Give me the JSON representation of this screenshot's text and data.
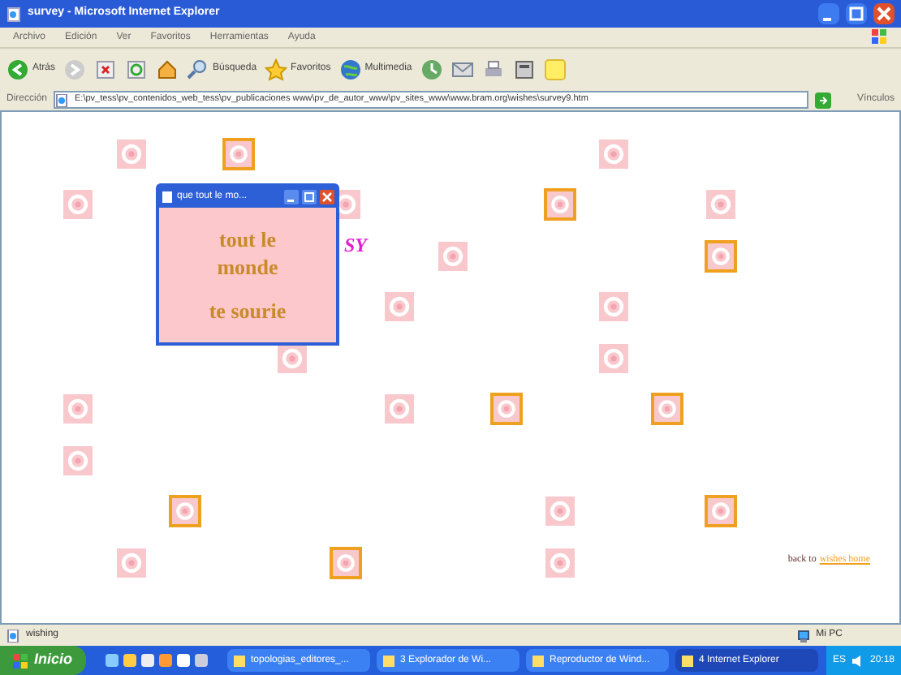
{
  "window": {
    "title": "survey - Microsoft Internet Explorer"
  },
  "menu": [
    "Archivo",
    "Edición",
    "Ver",
    "Favoritos",
    "Herramientas",
    "Ayuda"
  ],
  "toolbar": [
    {
      "kind": "back",
      "label": "Atrás"
    },
    {
      "kind": "forward"
    },
    {
      "kind": "stop"
    },
    {
      "kind": "refresh"
    },
    {
      "kind": "home"
    },
    {
      "kind": "search",
      "label": "Búsqueda"
    },
    {
      "kind": "favorites",
      "label": "Favoritos"
    },
    {
      "kind": "media",
      "label": "Multimedia"
    },
    {
      "kind": "history"
    },
    {
      "kind": "mail"
    },
    {
      "kind": "print"
    },
    {
      "kind": "edit"
    },
    {
      "kind": "note"
    }
  ],
  "address": {
    "label": "Dirección",
    "value": "E:\\pv_tess\\pv_contenidos_web_tess\\pv_publicaciones www\\pv_de_autor_www\\pv_sites_www\\www.bram.org\\wishes\\survey9.htm",
    "links": "Vínculos"
  },
  "grid": [
    {
      "cells": [
        {
          "kind": "empty"
        },
        {
          "kind": "tile"
        },
        {
          "kind": "empty"
        },
        {
          "kind": "framed"
        },
        {
          "kind": "empty"
        },
        {
          "kind": "empty"
        },
        {
          "kind": "empty"
        },
        {
          "kind": "empty"
        },
        {
          "kind": "empty"
        },
        {
          "kind": "empty"
        },
        {
          "kind": "tile"
        },
        {
          "kind": "empty"
        },
        {
          "kind": "empty"
        }
      ]
    },
    {
      "cells": [
        {
          "kind": "tile"
        },
        {
          "kind": "empty"
        },
        {
          "kind": "empty"
        },
        {
          "kind": "empty"
        },
        {
          "kind": "empty"
        },
        {
          "kind": "tile"
        },
        {
          "kind": "empty"
        },
        {
          "kind": "empty"
        },
        {
          "kind": "empty"
        },
        {
          "kind": "framed"
        },
        {
          "kind": "empty"
        },
        {
          "kind": "empty"
        },
        {
          "kind": "tile"
        }
      ]
    },
    {
      "cells": [
        {
          "kind": "empty"
        },
        {
          "kind": "empty"
        },
        {
          "kind": "empty"
        },
        {
          "kind": "empty"
        },
        {
          "kind": "empty"
        },
        {
          "kind": "empty"
        },
        {
          "kind": "empty"
        },
        {
          "kind": "tile"
        },
        {
          "kind": "empty"
        },
        {
          "kind": "empty"
        },
        {
          "kind": "empty"
        },
        {
          "kind": "empty"
        },
        {
          "kind": "framed"
        }
      ]
    },
    {
      "cells": [
        {
          "kind": "empty"
        },
        {
          "kind": "empty"
        },
        {
          "kind": "empty"
        },
        {
          "kind": "empty"
        },
        {
          "kind": "empty"
        },
        {
          "kind": "empty"
        },
        {
          "kind": "tile"
        },
        {
          "kind": "empty"
        },
        {
          "kind": "empty"
        },
        {
          "kind": "empty"
        },
        {
          "kind": "tile"
        },
        {
          "kind": "empty"
        },
        {
          "kind": "empty"
        }
      ]
    },
    {
      "cells": [
        {
          "kind": "empty"
        },
        {
          "kind": "empty"
        },
        {
          "kind": "empty"
        },
        {
          "kind": "empty"
        },
        {
          "kind": "tile"
        },
        {
          "kind": "empty"
        },
        {
          "kind": "empty"
        },
        {
          "kind": "empty"
        },
        {
          "kind": "empty"
        },
        {
          "kind": "empty"
        },
        {
          "kind": "tile"
        },
        {
          "kind": "empty"
        },
        {
          "kind": "empty"
        }
      ]
    },
    {
      "cells": [
        {
          "kind": "tile"
        },
        {
          "kind": "empty"
        },
        {
          "kind": "empty"
        },
        {
          "kind": "empty"
        },
        {
          "kind": "empty"
        },
        {
          "kind": "empty"
        },
        {
          "kind": "tile"
        },
        {
          "kind": "empty"
        },
        {
          "kind": "framed"
        },
        {
          "kind": "empty"
        },
        {
          "kind": "empty"
        },
        {
          "kind": "framed"
        },
        {
          "kind": "empty"
        }
      ]
    },
    {
      "cells": [
        {
          "kind": "tile"
        },
        {
          "kind": "empty"
        },
        {
          "kind": "empty"
        },
        {
          "kind": "empty"
        },
        {
          "kind": "empty"
        },
        {
          "kind": "empty"
        },
        {
          "kind": "empty"
        },
        {
          "kind": "empty"
        },
        {
          "kind": "empty"
        },
        {
          "kind": "empty"
        },
        {
          "kind": "empty"
        },
        {
          "kind": "empty"
        },
        {
          "kind": "empty"
        }
      ]
    },
    {
      "cells": [
        {
          "kind": "empty"
        },
        {
          "kind": "empty"
        },
        {
          "kind": "framed"
        },
        {
          "kind": "empty"
        },
        {
          "kind": "empty"
        },
        {
          "kind": "empty"
        },
        {
          "kind": "empty"
        },
        {
          "kind": "empty"
        },
        {
          "kind": "empty"
        },
        {
          "kind": "tile"
        },
        {
          "kind": "empty"
        },
        {
          "kind": "empty"
        },
        {
          "kind": "framed"
        }
      ]
    },
    {
      "cells": [
        {
          "kind": "empty"
        },
        {
          "kind": "tile"
        },
        {
          "kind": "empty"
        },
        {
          "kind": "empty"
        },
        {
          "kind": "empty"
        },
        {
          "kind": "framed"
        },
        {
          "kind": "empty"
        },
        {
          "kind": "empty"
        },
        {
          "kind": "empty"
        },
        {
          "kind": "tile"
        },
        {
          "kind": "empty"
        },
        {
          "kind": "empty"
        },
        {
          "kind": "empty"
        }
      ]
    }
  ],
  "popup": {
    "title": "que tout le mo...",
    "lines": [
      "tout le",
      "monde",
      "te sourie"
    ]
  },
  "mark": "SY",
  "back_link": {
    "text": "back to",
    "link": "wishes home"
  },
  "status_bar": {
    "text": "wishing",
    "zone": "Mi PC"
  },
  "taskbar": {
    "start": "Inicio",
    "tasks": [
      {
        "label": "topologias_editores_...",
        "selected": false
      },
      {
        "label": "3 Explorador de Wi...",
        "selected": false
      },
      {
        "label": "Reproductor de Wind...",
        "selected": false
      },
      {
        "label": "4 Internet Explorer",
        "selected": true
      }
    ],
    "lang": "ES",
    "clock": "20:18"
  }
}
